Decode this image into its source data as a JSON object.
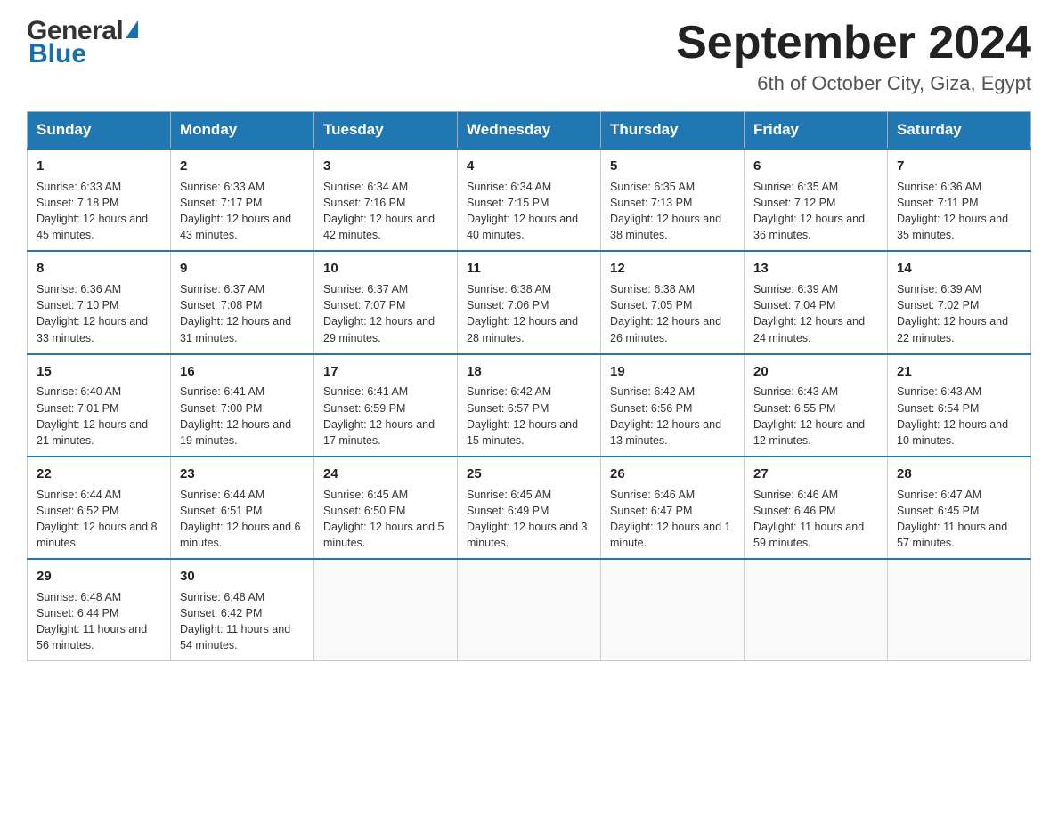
{
  "header": {
    "logo_general": "General",
    "logo_blue": "Blue",
    "month_year": "September 2024",
    "location": "6th of October City, Giza, Egypt"
  },
  "weekdays": [
    "Sunday",
    "Monday",
    "Tuesday",
    "Wednesday",
    "Thursday",
    "Friday",
    "Saturday"
  ],
  "weeks": [
    [
      {
        "day": "1",
        "sunrise": "6:33 AM",
        "sunset": "7:18 PM",
        "daylight": "12 hours and 45 minutes."
      },
      {
        "day": "2",
        "sunrise": "6:33 AM",
        "sunset": "7:17 PM",
        "daylight": "12 hours and 43 minutes."
      },
      {
        "day": "3",
        "sunrise": "6:34 AM",
        "sunset": "7:16 PM",
        "daylight": "12 hours and 42 minutes."
      },
      {
        "day": "4",
        "sunrise": "6:34 AM",
        "sunset": "7:15 PM",
        "daylight": "12 hours and 40 minutes."
      },
      {
        "day": "5",
        "sunrise": "6:35 AM",
        "sunset": "7:13 PM",
        "daylight": "12 hours and 38 minutes."
      },
      {
        "day": "6",
        "sunrise": "6:35 AM",
        "sunset": "7:12 PM",
        "daylight": "12 hours and 36 minutes."
      },
      {
        "day": "7",
        "sunrise": "6:36 AM",
        "sunset": "7:11 PM",
        "daylight": "12 hours and 35 minutes."
      }
    ],
    [
      {
        "day": "8",
        "sunrise": "6:36 AM",
        "sunset": "7:10 PM",
        "daylight": "12 hours and 33 minutes."
      },
      {
        "day": "9",
        "sunrise": "6:37 AM",
        "sunset": "7:08 PM",
        "daylight": "12 hours and 31 minutes."
      },
      {
        "day": "10",
        "sunrise": "6:37 AM",
        "sunset": "7:07 PM",
        "daylight": "12 hours and 29 minutes."
      },
      {
        "day": "11",
        "sunrise": "6:38 AM",
        "sunset": "7:06 PM",
        "daylight": "12 hours and 28 minutes."
      },
      {
        "day": "12",
        "sunrise": "6:38 AM",
        "sunset": "7:05 PM",
        "daylight": "12 hours and 26 minutes."
      },
      {
        "day": "13",
        "sunrise": "6:39 AM",
        "sunset": "7:04 PM",
        "daylight": "12 hours and 24 minutes."
      },
      {
        "day": "14",
        "sunrise": "6:39 AM",
        "sunset": "7:02 PM",
        "daylight": "12 hours and 22 minutes."
      }
    ],
    [
      {
        "day": "15",
        "sunrise": "6:40 AM",
        "sunset": "7:01 PM",
        "daylight": "12 hours and 21 minutes."
      },
      {
        "day": "16",
        "sunrise": "6:41 AM",
        "sunset": "7:00 PM",
        "daylight": "12 hours and 19 minutes."
      },
      {
        "day": "17",
        "sunrise": "6:41 AM",
        "sunset": "6:59 PM",
        "daylight": "12 hours and 17 minutes."
      },
      {
        "day": "18",
        "sunrise": "6:42 AM",
        "sunset": "6:57 PM",
        "daylight": "12 hours and 15 minutes."
      },
      {
        "day": "19",
        "sunrise": "6:42 AM",
        "sunset": "6:56 PM",
        "daylight": "12 hours and 13 minutes."
      },
      {
        "day": "20",
        "sunrise": "6:43 AM",
        "sunset": "6:55 PM",
        "daylight": "12 hours and 12 minutes."
      },
      {
        "day": "21",
        "sunrise": "6:43 AM",
        "sunset": "6:54 PM",
        "daylight": "12 hours and 10 minutes."
      }
    ],
    [
      {
        "day": "22",
        "sunrise": "6:44 AM",
        "sunset": "6:52 PM",
        "daylight": "12 hours and 8 minutes."
      },
      {
        "day": "23",
        "sunrise": "6:44 AM",
        "sunset": "6:51 PM",
        "daylight": "12 hours and 6 minutes."
      },
      {
        "day": "24",
        "sunrise": "6:45 AM",
        "sunset": "6:50 PM",
        "daylight": "12 hours and 5 minutes."
      },
      {
        "day": "25",
        "sunrise": "6:45 AM",
        "sunset": "6:49 PM",
        "daylight": "12 hours and 3 minutes."
      },
      {
        "day": "26",
        "sunrise": "6:46 AM",
        "sunset": "6:47 PM",
        "daylight": "12 hours and 1 minute."
      },
      {
        "day": "27",
        "sunrise": "6:46 AM",
        "sunset": "6:46 PM",
        "daylight": "11 hours and 59 minutes."
      },
      {
        "day": "28",
        "sunrise": "6:47 AM",
        "sunset": "6:45 PM",
        "daylight": "11 hours and 57 minutes."
      }
    ],
    [
      {
        "day": "29",
        "sunrise": "6:48 AM",
        "sunset": "6:44 PM",
        "daylight": "11 hours and 56 minutes."
      },
      {
        "day": "30",
        "sunrise": "6:48 AM",
        "sunset": "6:42 PM",
        "daylight": "11 hours and 54 minutes."
      },
      null,
      null,
      null,
      null,
      null
    ]
  ]
}
